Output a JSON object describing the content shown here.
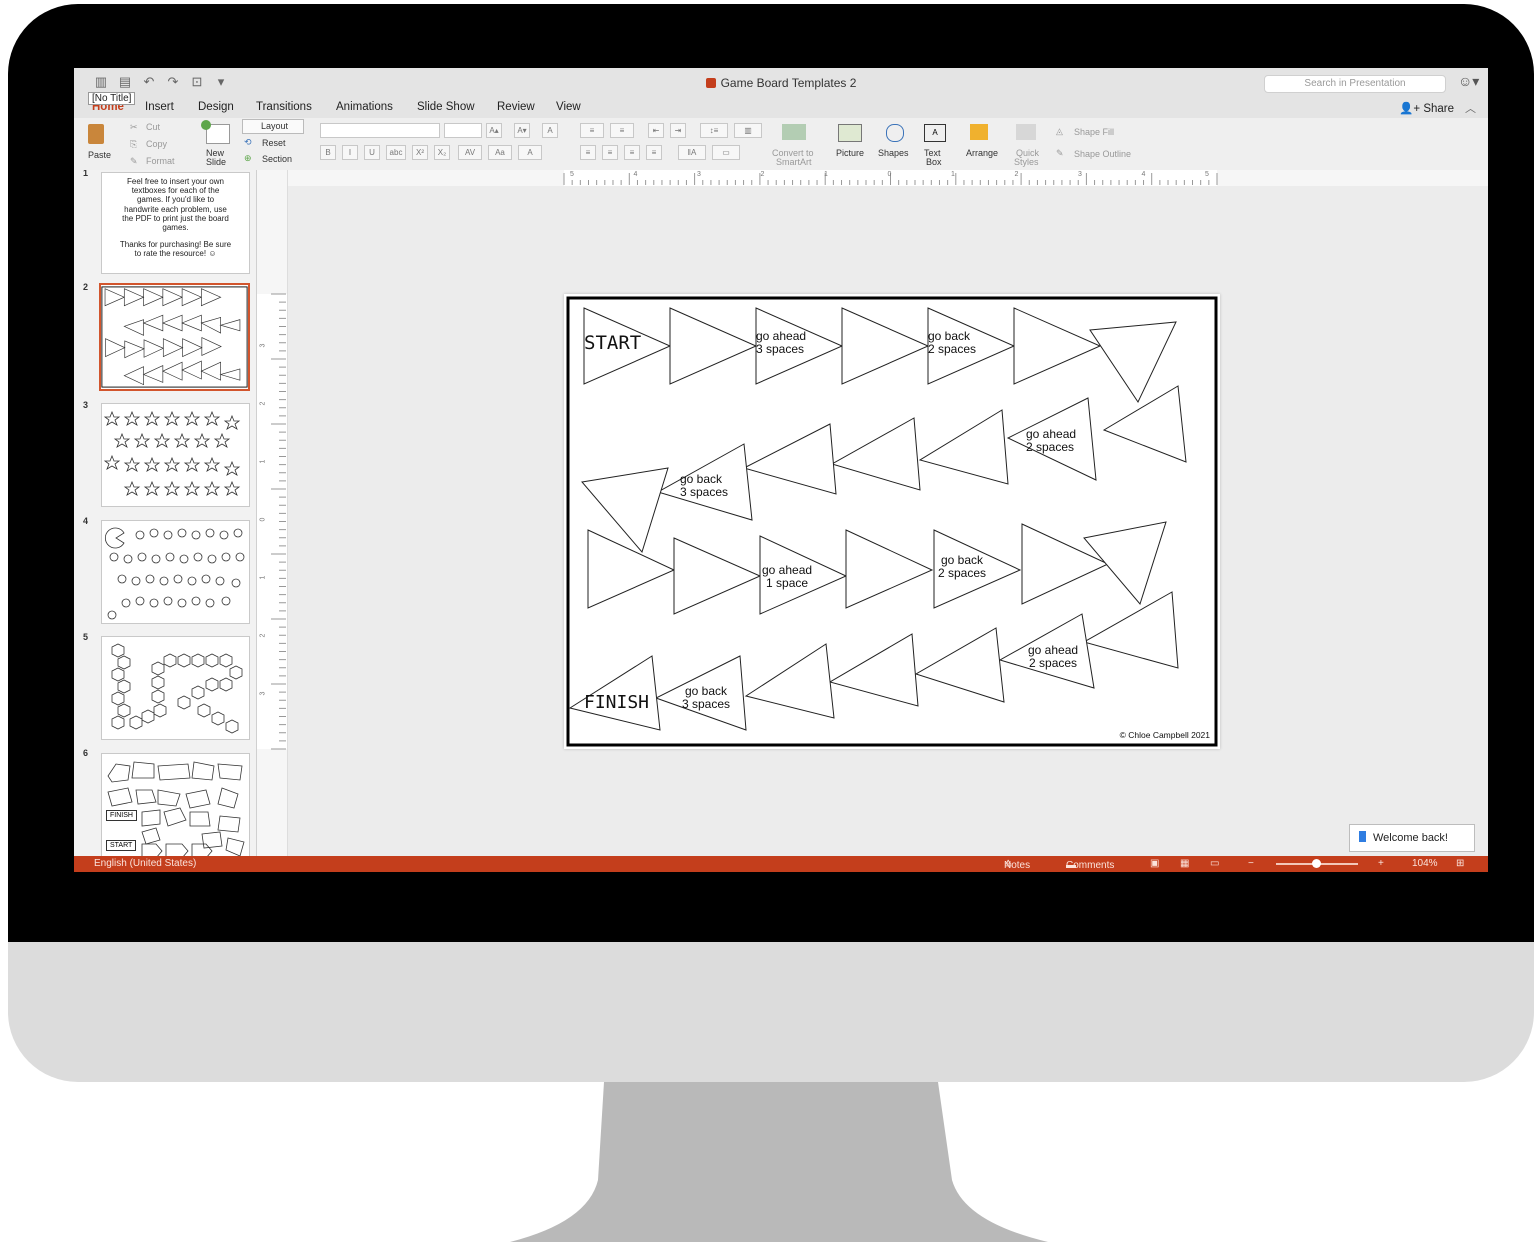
{
  "window": {
    "title": "Game Board Templates 2",
    "tooltip": "[No Title]"
  },
  "search": {
    "placeholder": "Search in Presentation"
  },
  "tabs": [
    "Home",
    "Insert",
    "Design",
    "Transitions",
    "Animations",
    "Slide Show",
    "Review",
    "View"
  ],
  "share_label": "Share",
  "ribbon": {
    "paste": "Paste",
    "cut": "Cut",
    "copy": "Copy",
    "format": "Format",
    "new_slide": [
      "New",
      "Slide"
    ],
    "layout": "Layout",
    "reset": "Reset",
    "section": "Section",
    "convert": [
      "Convert to",
      "SmartArt"
    ],
    "picture": "Picture",
    "shapes": "Shapes",
    "text_box": [
      "Text",
      "Box"
    ],
    "arrange": "Arrange",
    "quick_styles": [
      "Quick",
      "Styles"
    ],
    "shape_fill": "Shape Fill",
    "shape_outline": "Shape Outline",
    "font_buttons": [
      "B",
      "I",
      "U",
      "abc",
      "X²",
      "X₂"
    ]
  },
  "thumbnails": [
    {
      "number": "1",
      "text": [
        "Feel free to insert your own",
        "textboxes for each of the",
        "games. If you'd like to",
        "handwrite each problem, use",
        "the PDF to print just the board",
        "games.",
        "",
        "Thanks for purchasing! Be sure",
        "to rate the resource! ☺"
      ]
    },
    {
      "number": "2"
    },
    {
      "number": "3"
    },
    {
      "number": "4"
    },
    {
      "number": "5"
    },
    {
      "number": "6",
      "labels": [
        "FINISH",
        "START"
      ]
    }
  ],
  "hruler_ticks": [
    "5",
    "4",
    "3",
    "2",
    "1",
    "0",
    "1",
    "2",
    "3",
    "4",
    "5"
  ],
  "vruler_ticks": [
    "3",
    "2",
    "1",
    "0",
    "1",
    "2",
    "3"
  ],
  "slide": {
    "start": "START",
    "finish": "FINISH",
    "copyright": "© Chloe Campbell 2021",
    "spaces": [
      [
        "go ahead",
        "3 spaces"
      ],
      [
        "go back",
        "2 spaces"
      ],
      [
        "go ahead",
        "2 spaces"
      ],
      [
        "go back",
        "3 spaces"
      ],
      [
        "go ahead",
        "1 space"
      ],
      [
        "go back",
        "2 spaces"
      ],
      [
        "go ahead",
        "2 spaces"
      ],
      [
        "go back",
        "3 spaces"
      ]
    ]
  },
  "welcome": "Welcome back!",
  "status": {
    "language": "English (United States)",
    "notes": "Notes",
    "comments": "Comments",
    "zoom": "104%",
    "minus": "−",
    "plus": "+"
  }
}
